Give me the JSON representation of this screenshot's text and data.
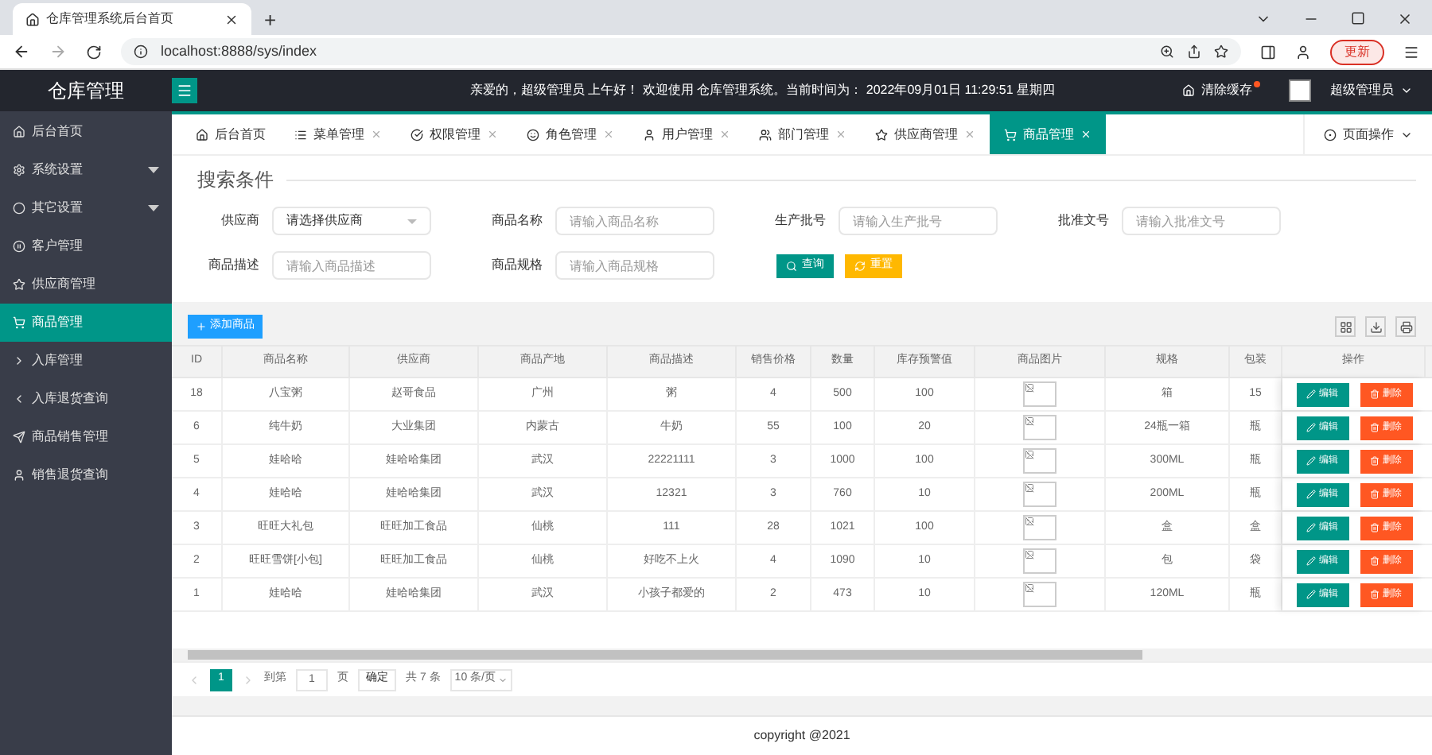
{
  "browser": {
    "tab_title": "仓库管理系统后台首页",
    "new_tab": "+",
    "url": "localhost:8888/sys/index",
    "update_button": "更新"
  },
  "header": {
    "logo": "仓库管理",
    "greeting": "亲爱的，超级管理员 上午好！ 欢迎使用 仓库管理系统。当前时间为： 2022年09月01日 11:29:51   星期四",
    "clear_cache": "清除缓存",
    "user": "超级管理员"
  },
  "sidebar": {
    "items": [
      {
        "label": "后台首页",
        "selected": false,
        "expandable": false
      },
      {
        "label": "系统设置",
        "selected": false,
        "expandable": true
      },
      {
        "label": "其它设置",
        "selected": false,
        "expandable": true
      },
      {
        "label": "客户管理",
        "selected": false,
        "expandable": false
      },
      {
        "label": "供应商管理",
        "selected": false,
        "expandable": false
      },
      {
        "label": "商品管理",
        "selected": true,
        "expandable": false
      },
      {
        "label": "入库管理",
        "selected": false,
        "expandable": false
      },
      {
        "label": "入库退货查询",
        "selected": false,
        "expandable": false
      },
      {
        "label": "商品销售管理",
        "selected": false,
        "expandable": false
      },
      {
        "label": "销售退货查询",
        "selected": false,
        "expandable": false
      }
    ]
  },
  "tabs": [
    {
      "label": "后台首页",
      "selected": false,
      "closable": false
    },
    {
      "label": "菜单管理",
      "selected": false,
      "closable": true
    },
    {
      "label": "权限管理",
      "selected": false,
      "closable": true
    },
    {
      "label": "角色管理",
      "selected": false,
      "closable": true
    },
    {
      "label": "用户管理",
      "selected": false,
      "closable": true
    },
    {
      "label": "部门管理",
      "selected": false,
      "closable": true
    },
    {
      "label": "供应商管理",
      "selected": false,
      "closable": true
    },
    {
      "label": "商品管理",
      "selected": true,
      "closable": true
    }
  ],
  "page_actions": "页面操作",
  "search": {
    "legend": "搜索条件",
    "fields": [
      {
        "kind": "select",
        "label": "供应商",
        "placeholder": "请选择供应商"
      },
      {
        "kind": "text",
        "label": "商品名称",
        "placeholder": "请输入商品名称"
      },
      {
        "kind": "text",
        "label": "生产批号",
        "placeholder": "请输入生产批号"
      },
      {
        "kind": "text",
        "label": "批准文号",
        "placeholder": "请输入批准文号"
      },
      {
        "kind": "text",
        "label": "商品描述",
        "placeholder": "请输入商品描述"
      },
      {
        "kind": "text",
        "label": "商品规格",
        "placeholder": "请输入商品规格"
      }
    ],
    "buttons": [
      {
        "kind": "search",
        "label": "查询"
      },
      {
        "kind": "reset",
        "label": "重置"
      }
    ]
  },
  "add_button": "添加商品",
  "table": {
    "columns": [
      "ID",
      "商品名称",
      "供应商",
      "商品产地",
      "商品描述",
      "销售价格",
      "数量",
      "库存预警值",
      "商品图片",
      "规格",
      "包装",
      "操作"
    ],
    "rows": [
      {
        "cells": [
          "18",
          "八宝粥",
          "赵哥食品",
          "广州",
          "粥",
          "4",
          "500",
          "100",
          "",
          "箱",
          "15"
        ],
        "actions": [
          "编辑",
          "删除"
        ]
      },
      {
        "cells": [
          "6",
          "纯牛奶",
          "大业集团",
          "内蒙古",
          "牛奶",
          "55",
          "100",
          "20",
          "",
          "24瓶一箱",
          "瓶"
        ],
        "actions": [
          "编辑",
          "删除"
        ]
      },
      {
        "cells": [
          "5",
          "娃哈哈",
          "娃哈哈集团",
          "武汉",
          "22221111",
          "3",
          "1000",
          "100",
          "",
          "300ML",
          "瓶"
        ],
        "actions": [
          "编辑",
          "删除"
        ]
      },
      {
        "cells": [
          "4",
          "娃哈哈",
          "娃哈哈集团",
          "武汉",
          "12321",
          "3",
          "760",
          "10",
          "",
          "200ML",
          "瓶"
        ],
        "actions": [
          "编辑",
          "删除"
        ]
      },
      {
        "cells": [
          "3",
          "旺旺大礼包",
          "旺旺加工食品",
          "仙桃",
          "111",
          "28",
          "1021",
          "100",
          "",
          "盒",
          "盒"
        ],
        "actions": [
          "编辑",
          "删除"
        ]
      },
      {
        "cells": [
          "2",
          "旺旺雪饼[小包]",
          "旺旺加工食品",
          "仙桃",
          "好吃不上火",
          "4",
          "1090",
          "10",
          "",
          "包",
          "袋"
        ],
        "actions": [
          "编辑",
          "删除"
        ]
      },
      {
        "cells": [
          "1",
          "娃哈哈",
          "娃哈哈集团",
          "武汉",
          "小孩子都爱的",
          "2",
          "473",
          "10",
          "",
          "120ML",
          "瓶"
        ],
        "actions": [
          "编辑",
          "删除"
        ]
      }
    ]
  },
  "pagination": {
    "pages": [
      {
        "label": "1",
        "selected": true
      }
    ],
    "goto": "到第",
    "page_value": "1",
    "page_unit": "页",
    "confirm": "确定",
    "total": "共 7 条",
    "page_size": "10 条/页"
  },
  "footer": "copyright @2021"
}
